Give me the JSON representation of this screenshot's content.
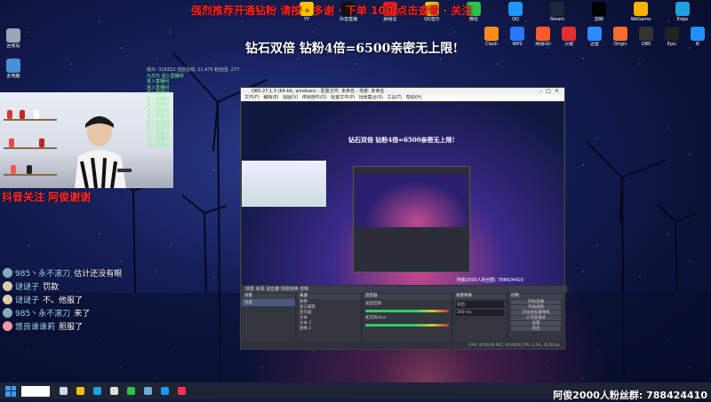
{
  "overlay": {
    "top_title": "强烈推荐开通钻粉 请按 · 多谢 · 下单 100 点击查看 · 关注",
    "promo": "钻石双倍 钻粉4倍=6500亲密无上限!",
    "follow": "抖音关注 阿俊谢谢",
    "fan_group": "阿俊2000人粉丝群: 788424410"
  },
  "chat": [
    {
      "name": "985丶永不滚刀",
      "text": "估计还没有眼"
    },
    {
      "name": "谜谜子",
      "text": "罚款"
    },
    {
      "name": "谜谜子",
      "text": "不。他服了"
    },
    {
      "name": "985丶永不滚刀",
      "text": "来了"
    },
    {
      "name": "悠良谁谁莉",
      "text": "胆服了"
    }
  ],
  "chatlog": {
    "header": "观众: 319322   当前在线: 21,475   粉丝团: 277",
    "lines": [
      "九次元 进入直播间",
      "进入直播间",
      "进入直播间",
      "进入直播间",
      "进入直播间",
      "进入直播间",
      "进入直播间",
      "进入直播间",
      "进入直播间",
      "进入直播间",
      "进入直播间",
      "进入直播间",
      "进入直播间"
    ]
  },
  "desktop_icons_left": [
    {
      "label": "回收站",
      "icon": "recycle-bin-icon",
      "color": "#9aa6b8"
    },
    {
      "label": "此电脑",
      "icon": "computer-icon",
      "color": "#4a8fd8"
    }
  ],
  "desktop_icons_top": [
    {
      "label": "YY",
      "icon": "yy-icon",
      "color": "#f5c400"
    },
    {
      "label": "抖音直播",
      "icon": "douyin-icon",
      "color": "#111111"
    },
    {
      "label": "网易云",
      "icon": "netease-icon",
      "color": "#e02020"
    },
    {
      "label": "QQ音乐",
      "icon": "qqmusic-icon",
      "color": "#f5c400"
    },
    {
      "label": "微信",
      "icon": "wechat-icon",
      "color": "#2ec14a"
    },
    {
      "label": "QQ",
      "icon": "qq-icon",
      "color": "#2196f3"
    },
    {
      "label": "Steam",
      "icon": "steam-icon",
      "color": "#1b2838"
    },
    {
      "label": "剪映",
      "icon": "jianying-icon",
      "color": "#000000"
    },
    {
      "label": "WeGame",
      "icon": "wegame-icon",
      "color": "#ffb000"
    },
    {
      "label": "Edge",
      "icon": "edge-icon",
      "color": "#1fa0e0"
    }
  ],
  "desktop_icons_row2": [
    {
      "label": "Clash",
      "icon": "clash-icon",
      "color": "#ff8c1a"
    },
    {
      "label": "WPS",
      "icon": "wps-icon",
      "color": "#2979ff"
    },
    {
      "label": "网易UU",
      "icon": "uu-icon",
      "color": "#ff5a2a"
    },
    {
      "label": "火绒",
      "icon": "huorong-icon",
      "color": "#e03030"
    },
    {
      "label": "迅雷",
      "icon": "thunder-icon",
      "color": "#2a8cff"
    },
    {
      "label": "Origin",
      "icon": "origin-icon",
      "color": "#f56c2d"
    },
    {
      "label": "OBS",
      "icon": "obs-icon",
      "color": "#333333"
    },
    {
      "label": "Epic",
      "icon": "epic-icon",
      "color": "#222222"
    },
    {
      "label": "IE",
      "icon": "ie-icon",
      "color": "#1e90ff"
    }
  ],
  "obs": {
    "title": "OBS 27.1.3 (64-bit, windows) - 配置文件: 未命名 - 场景: 未命名",
    "menu": "文件(F)  编辑(E)  视图(V)  停靠部件(D)  配置文件(P)  场景集合(S)  工具(T)  帮助(H)",
    "preview_promo": "钻石双倍 钻粉4倍=6500亲密无上限!",
    "preview_banner": "阿俊2000人粉丝群: 788424410",
    "dock_header": "场景  来源  混音器  场景转换  控制",
    "scenes_title": "场景",
    "scenes": [
      "场景"
    ],
    "sources_title": "来源",
    "sources": [
      "图像",
      "窗口捕获",
      "显示器",
      "文本",
      "文本 2",
      "图像 2"
    ],
    "mixer_title": "混音器",
    "mixer": [
      "桌面音频",
      "麦克风/Aux"
    ],
    "transitions_title": "场景转换",
    "transition": "淡出",
    "duration": "300 ms",
    "controls_title": "控制",
    "controls": [
      "开始直播",
      "开始录制",
      "启动虚拟摄像机",
      "工作室模式",
      "设置",
      "退出"
    ],
    "status": "LIVE: 00:00:00   REC: 00:00:00   CPU: 2.5%, 30.00 fps"
  },
  "taskbar": {
    "apps": [
      {
        "icon": "taskview-icon",
        "color": "#cfd8e6"
      },
      {
        "icon": "explorer-icon",
        "color": "#f5c000"
      },
      {
        "icon": "edge-icon",
        "color": "#1fa0e0"
      },
      {
        "icon": "obs-icon",
        "color": "#dddddd"
      },
      {
        "icon": "wechat-icon",
        "color": "#2ec14a"
      },
      {
        "icon": "steam-icon",
        "color": "#6fa8dc"
      },
      {
        "icon": "qq-icon",
        "color": "#2196f3"
      },
      {
        "icon": "douyin-icon",
        "color": "#ff2d55"
      }
    ]
  }
}
